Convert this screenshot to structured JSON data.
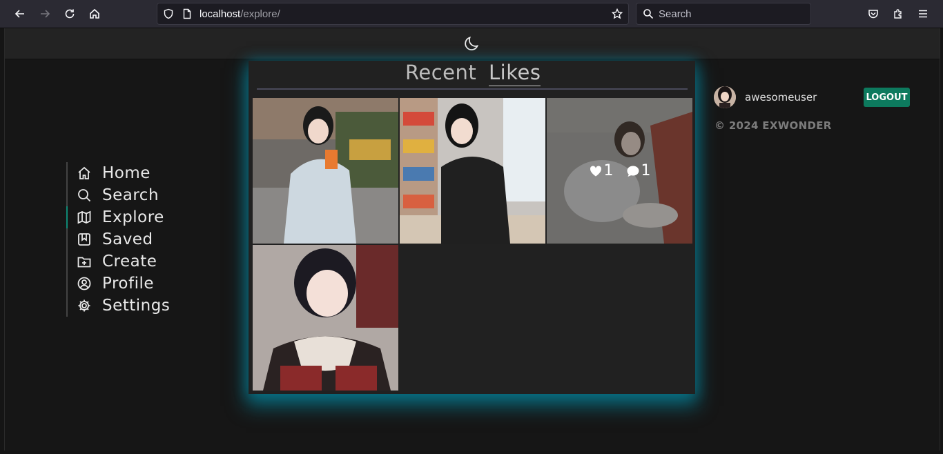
{
  "browser": {
    "url_host": "localhost",
    "url_path": "/explore/",
    "search_placeholder": "Search"
  },
  "nav": {
    "items": [
      {
        "label": "Home",
        "icon": "home-icon"
      },
      {
        "label": "Search",
        "icon": "search-icon"
      },
      {
        "label": "Explore",
        "icon": "map-icon",
        "active": true
      },
      {
        "label": "Saved",
        "icon": "bookmark-icon"
      },
      {
        "label": "Create",
        "icon": "folder-plus-icon"
      },
      {
        "label": "Profile",
        "icon": "user-circle-icon"
      },
      {
        "label": "Settings",
        "icon": "gear-icon"
      }
    ]
  },
  "feed": {
    "tabs": [
      {
        "label": "Recent",
        "active": false
      },
      {
        "label": "Likes",
        "active": true
      }
    ],
    "posts": [
      {
        "likes": "",
        "comments": ""
      },
      {
        "likes": "",
        "comments": ""
      },
      {
        "likes": "1",
        "comments": "1",
        "hovered": true
      },
      {
        "likes": "",
        "comments": ""
      }
    ]
  },
  "user": {
    "username": "awesomeuser",
    "logout_label": "LOGOUT"
  },
  "footer": {
    "copyright": "© 2024 EXWONDER"
  },
  "colors": {
    "accent": "#0f8a76",
    "logout_bg": "#0d7a5e",
    "panel_glow": "#00a0be"
  }
}
